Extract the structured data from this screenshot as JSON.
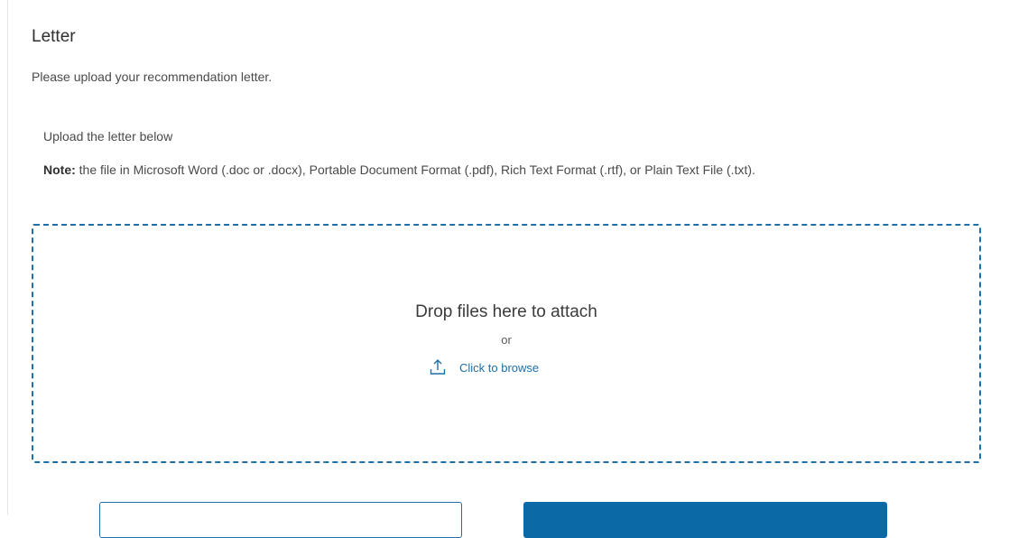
{
  "section": {
    "title": "Letter",
    "description": "Please upload your recommendation letter."
  },
  "upload": {
    "label": "Upload the letter below",
    "note_label": "Note:",
    "note_text": " the file in Microsoft Word (.doc or .docx), Portable Document Format (.pdf), Rich Text Format (.rtf), or Plain Text File (.txt)."
  },
  "dropzone": {
    "drop_text": "Drop files here to attach",
    "or_text": "or",
    "browse_label": "Click to browse",
    "icon": "upload-icon"
  },
  "colors": {
    "accent": "#1f6fa8",
    "primary_button": "#0b6aa6",
    "text": "#3b3b3b"
  }
}
